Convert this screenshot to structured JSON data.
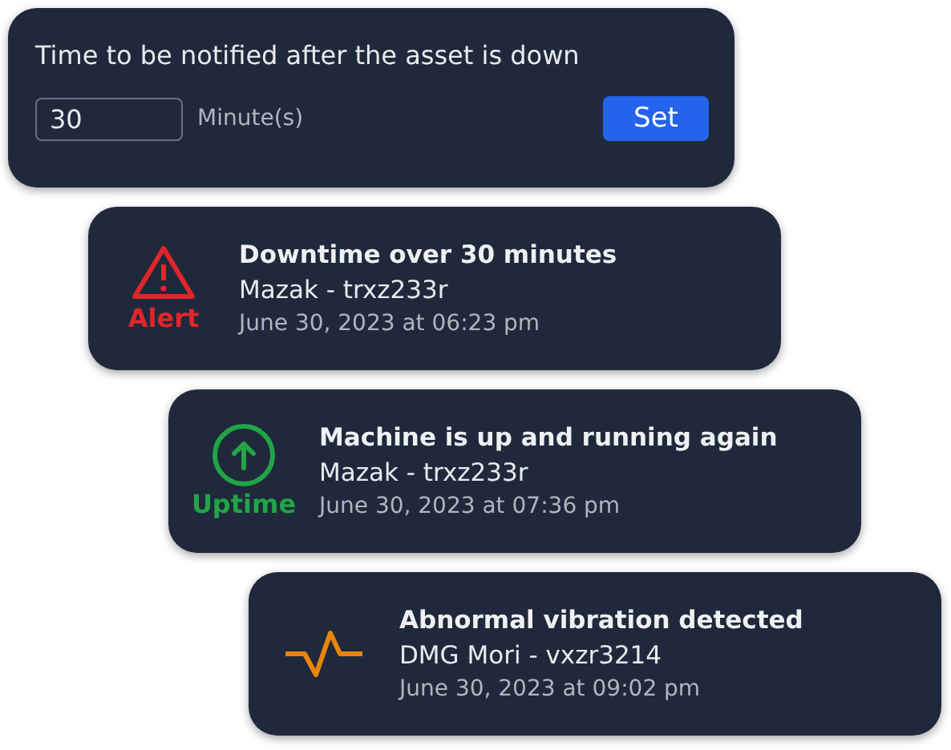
{
  "settings": {
    "prompt": "Time to be notified after the asset is down",
    "value": "30",
    "unit": "Minute(s)",
    "button": "Set"
  },
  "notifications": [
    {
      "kind": "alert",
      "color": "#e0262a",
      "label": "Alert",
      "title": "Downtime over 30 minutes",
      "asset": "Mazak - trxz233r",
      "time": "June 30, 2023 at 06:23 pm"
    },
    {
      "kind": "uptime",
      "color": "#22a447",
      "label": "Uptime",
      "title": "Machine is up and running again",
      "asset": "Mazak - trxz233r",
      "time": "June 30, 2023 at 07:36 pm"
    },
    {
      "kind": "vibration",
      "color": "#e8850c",
      "title": "Abnormal vibration detected",
      "asset": "DMG Mori - vxzr3214",
      "time": "June 30, 2023 at 09:02 pm"
    }
  ]
}
